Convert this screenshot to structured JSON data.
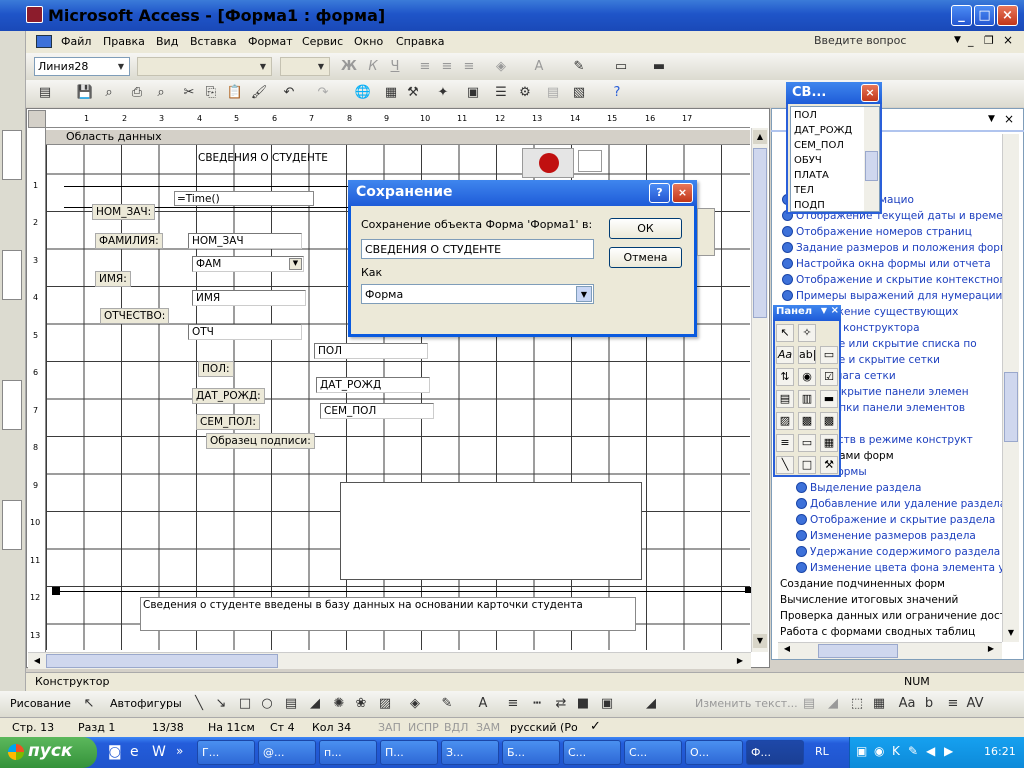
{
  "app": {
    "title": "Microsoft Access - [Форма1 : форма]"
  },
  "menu": {
    "items": [
      "Файл",
      "Правка",
      "Вид",
      "Вставка",
      "Формат",
      "Сервис",
      "Окно",
      "Справка"
    ],
    "help_placeholder": "Введите вопрос"
  },
  "toolbar": {
    "object_combo": "Линия28"
  },
  "form": {
    "section_label": "Область данных",
    "ruler_h": [
      "1",
      "2",
      "3",
      "4",
      "5",
      "6",
      "7",
      "8",
      "9",
      "10",
      "11",
      "12",
      "13",
      "14",
      "15",
      "16",
      "17"
    ],
    "ruler_v": [
      "1",
      "2",
      "3",
      "4",
      "5",
      "6",
      "7",
      "8",
      "9",
      "10",
      "11",
      "12",
      "13"
    ],
    "title_label": "СВЕДЕНИЯ О СТУДЕНТЕ",
    "time_field": "=Time()",
    "labels": {
      "nom": "НОМ_ЗАЧ:",
      "fam": "ФАМИЛИЯ:",
      "imya": "ИМЯ:",
      "otch": "ОТЧЕСТВО:",
      "pol": "ПОЛ:",
      "dat": "ДАТ_РОЖД:",
      "sem": "СЕМ_ПОЛ:",
      "sign": "Образец подписи:"
    },
    "fields": {
      "nom": "НОМ_ЗАЧ",
      "fam": "ФАМ",
      "imya": "ИМЯ",
      "otch": "ОТЧ",
      "pol": "ПОЛ",
      "dat": "ДАТ_РОЖД",
      "sem": "СЕМ_ПОЛ"
    },
    "footer_text": "Сведения о студенте введены в базу данных на основании карточки студента"
  },
  "dialog": {
    "title": "Сохранение",
    "prompt": "Сохранение объекта Форма 'Форма1' в:",
    "name_value": "СВЕДЕНИЯ О СТУДЕНТЕ",
    "as_label": "Как",
    "as_value": "Форма",
    "ok": "ОК",
    "cancel": "Отмена"
  },
  "fieldlist": {
    "title": "СВ...",
    "items": [
      "ПОЛ",
      "ДАТ_РОЖД",
      "СЕМ_ПОЛ",
      "ОБУЧ",
      "ПЛАТА",
      "ТЕЛ",
      "ПОДП"
    ]
  },
  "toolbox": {
    "title": "Панел"
  },
  "taskpane": {
    "links": [
      "другого информацио",
      "Отображение текущей даты и времени",
      "Отображение номеров страниц",
      "Задание размеров и положения формы и",
      "Настройка окна формы или отчета",
      "Отображение и скрытие контекстного м",
      "Примеры выражений для нумерации стр",
      "отображение существующих",
      "режиме конструктора",
      "ражение или скрытие списка по",
      "ражение и скрытие сетки",
      "нение шага сетки",
      "тие и закрытие панели элемен",
      "ция кнопки панели элементов",
      "йств",
      "ие свойств в режиме конструкт"
    ],
    "plain_mid": "разделами форм",
    "sub_links": [
      "лы формы",
      "Выделение раздела",
      "Добавление или удаление раздела",
      "Отображение и скрытие раздела",
      "Изменение размеров раздела",
      "Удержание содержимого раздела в с",
      "Изменение цвета фона элемента упра"
    ],
    "plain": [
      "Создание подчиненных форм",
      "Вычисление итоговых значений",
      "Проверка данных или ограничение доступ",
      "Работа с формами сводных таблиц"
    ]
  },
  "status": {
    "mode": "Конструктор",
    "num": "NUM"
  },
  "drawbar": {
    "draw": "Рисование",
    "autoshapes": "Автофигуры",
    "change_text": "Изменить текст..."
  },
  "info": {
    "page": "Стр. 13",
    "section": "Разд 1",
    "pages": "13/38",
    "pos": "На 11см",
    "line": "Ст 4",
    "col": "Кол 34",
    "zap": "ЗАП",
    "ispr": "ИСПР",
    "vdl": "ВДЛ",
    "zam": "ЗАМ",
    "lang": "русский (Ро"
  },
  "taskbar": {
    "start": "пуск",
    "items": [
      "Г...",
      "@...",
      "п...",
      "П...",
      "З...",
      "Б...",
      "С...",
      "С...",
      "О...",
      "Ф..."
    ],
    "lang": "RL",
    "clock": "16:21"
  }
}
